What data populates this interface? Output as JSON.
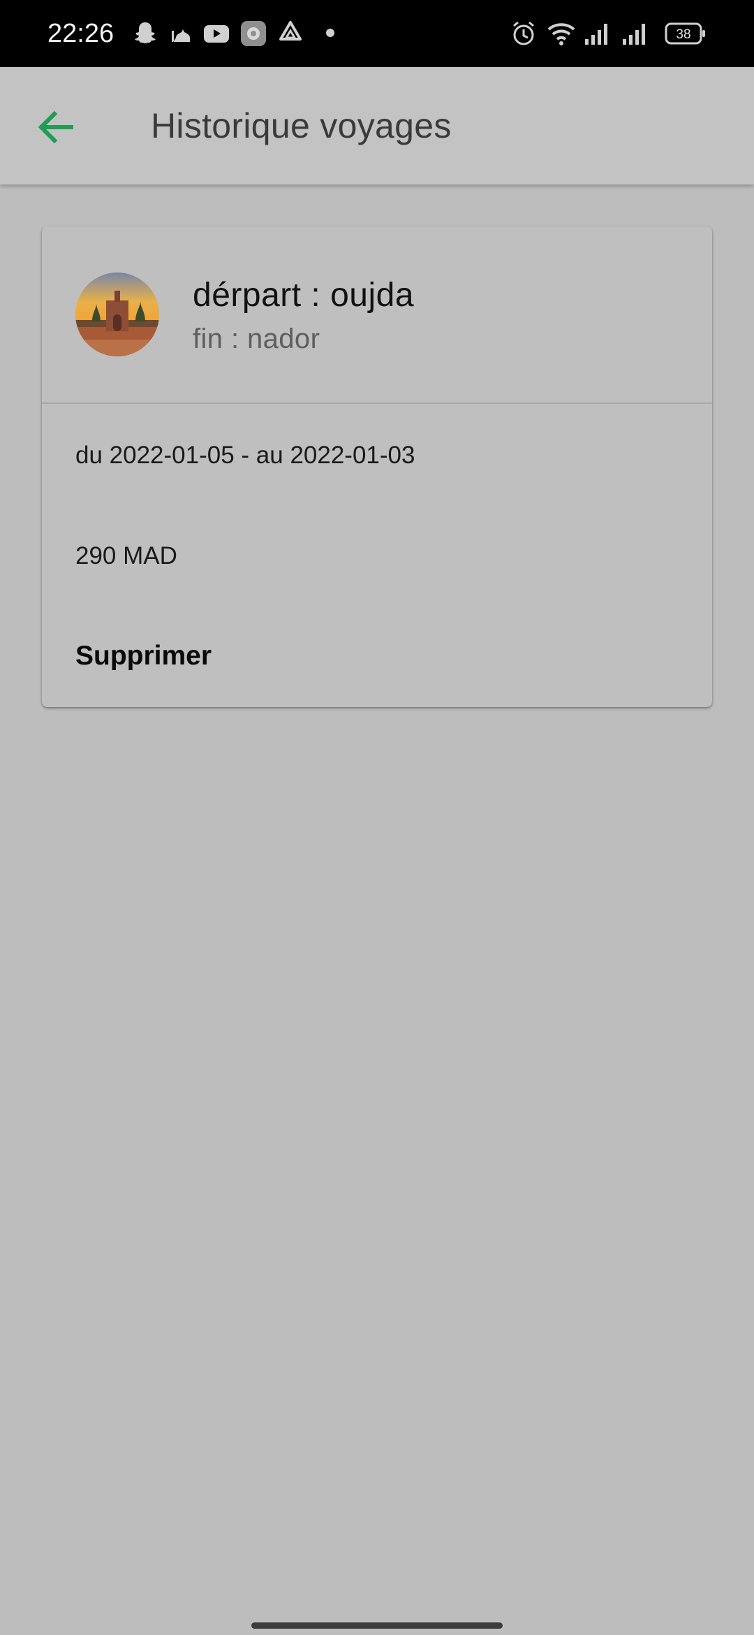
{
  "status_bar": {
    "time": "22:26",
    "battery": "38",
    "left_icons": [
      "snapchat-icon",
      "mosque-app-icon",
      "youtube-icon",
      "settings-app-icon",
      "recycle-app-icon",
      "dot-icon"
    ],
    "right_icons": [
      "alarm-icon",
      "wifi-icon",
      "signal-icon",
      "signal-icon",
      "battery-icon"
    ]
  },
  "app_bar": {
    "title": "Historique voyages",
    "back_icon": "arrow-left-icon",
    "accent_color": "#1f9d55"
  },
  "trips": [
    {
      "departure": "dérpart : oujda",
      "arrival": "fin : nador",
      "dates": "du 2022-01-05 - au 2022-01-03",
      "price": "290 MAD",
      "delete_label": "Supprimer",
      "avatar": "city-sunset-image"
    }
  ]
}
